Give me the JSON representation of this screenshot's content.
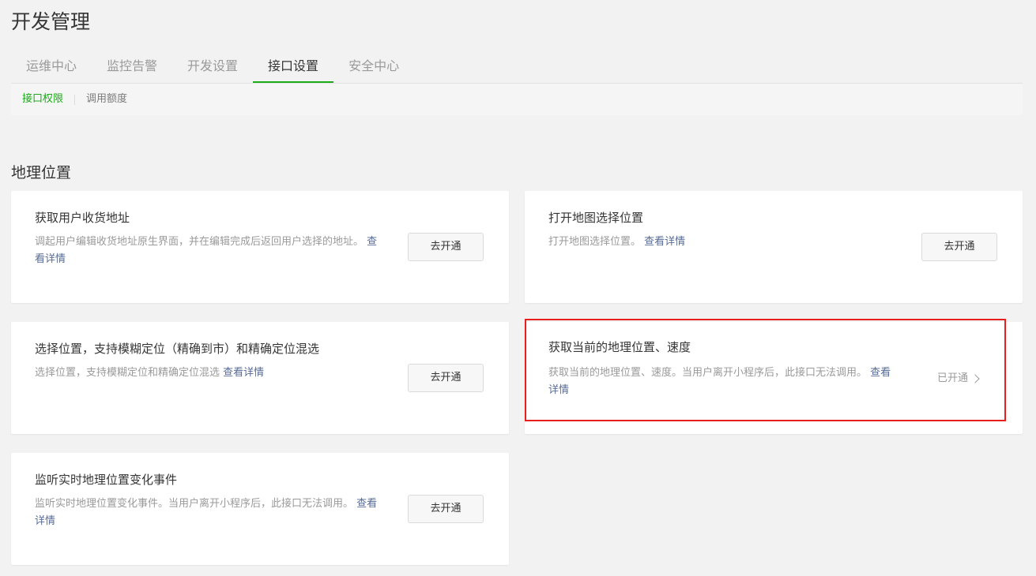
{
  "page": {
    "title": "开发管理"
  },
  "tabs": [
    {
      "label": "运维中心"
    },
    {
      "label": "监控告警"
    },
    {
      "label": "开发设置"
    },
    {
      "label": "接口设置"
    },
    {
      "label": "安全中心"
    }
  ],
  "active_tab": "接口设置",
  "subnav": [
    {
      "label": "接口权限"
    },
    {
      "label": "调用额度"
    }
  ],
  "active_subnav": "接口权限",
  "section": {
    "title": "地理位置"
  },
  "cards": [
    {
      "title": "获取用户收货地址",
      "desc": "调起用户编辑收货地址原生界面，并在编辑完成后返回用户选择的地址。",
      "link": "查看详情",
      "action": "去开通"
    },
    {
      "title": "打开地图选择位置",
      "desc": "打开地图选择位置。",
      "link": "查看详情",
      "action": "去开通"
    },
    {
      "title": "选择位置，支持模糊定位（精确到市）和精确定位混选",
      "desc": "选择位置，支持模糊定位和精确定位混选",
      "link": "查看详情",
      "action": "去开通"
    },
    {
      "title": "获取当前的地理位置、速度",
      "desc": "获取当前的地理位置、速度。当用户离开小程序后，此接口无法调用。",
      "link": "查看详情",
      "status": "已开通"
    },
    {
      "title": "监听实时地理位置变化事件",
      "desc": "监听实时地理位置变化事件。当用户离开小程序后，此接口无法调用。",
      "link": "查看详情",
      "action": "去开通"
    }
  ],
  "colors": {
    "accent": "#1aad19",
    "link": "#576b95",
    "highlight": "#e8201d"
  }
}
